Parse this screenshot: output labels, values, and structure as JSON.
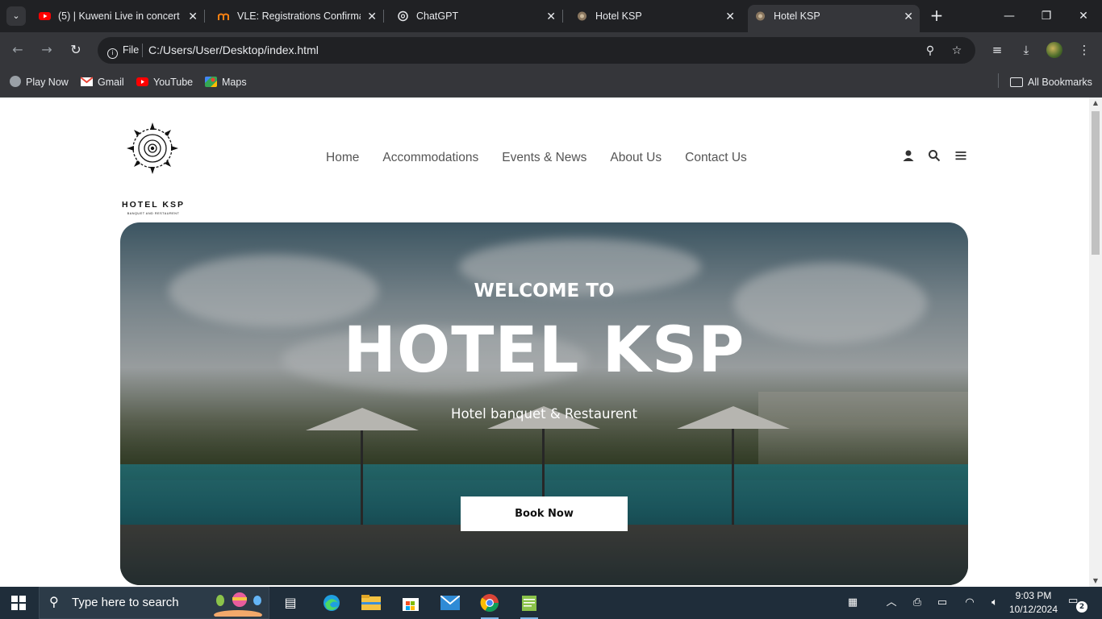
{
  "browser": {
    "tabs": [
      {
        "title": "(5) | Kuweni Live in concert 2",
        "icon": "youtube-icon"
      },
      {
        "title": "VLE: Registrations Confirmati",
        "icon": "moodle-icon"
      },
      {
        "title": "ChatGPT",
        "icon": "openai-icon"
      },
      {
        "title": "Hotel KSP",
        "icon": "hotel-favicon"
      },
      {
        "title": "Hotel KSP",
        "icon": "hotel-favicon",
        "active": true
      }
    ],
    "close_glyph": "✕",
    "newtab_glyph": "+",
    "address": {
      "scheme_chip": "File",
      "url": "C:/Users/User/Desktop/index.html"
    },
    "bookmarks": [
      {
        "label": "Play Now",
        "icon": "globe-icon"
      },
      {
        "label": "Gmail",
        "icon": "gmail-icon"
      },
      {
        "label": "YouTube",
        "icon": "youtube-icon"
      },
      {
        "label": "Maps",
        "icon": "maps-icon"
      }
    ],
    "all_bookmarks": "All Bookmarks"
  },
  "site": {
    "logo": {
      "name": "HOTEL KSP",
      "tagline": "BANQUET AND RESTAURENT"
    },
    "nav": [
      "Home",
      "Accommodations",
      "Events & News",
      "About Us",
      "Contact Us"
    ],
    "hero": {
      "eyebrow": "WELCOME TO",
      "title": "HOTEL KSP",
      "subtitle": "Hotel banquet & Restaurent",
      "cta": "Book Now"
    }
  },
  "taskbar": {
    "search_placeholder": "Type here to search",
    "time": "9:03 PM",
    "date": "10/12/2024",
    "notification_count": "2"
  },
  "colors": {
    "chrome_dark": "#202124",
    "chrome_toolbar": "#35363a",
    "taskbar": "#1f2d3a",
    "youtube_red": "#ff0000"
  }
}
